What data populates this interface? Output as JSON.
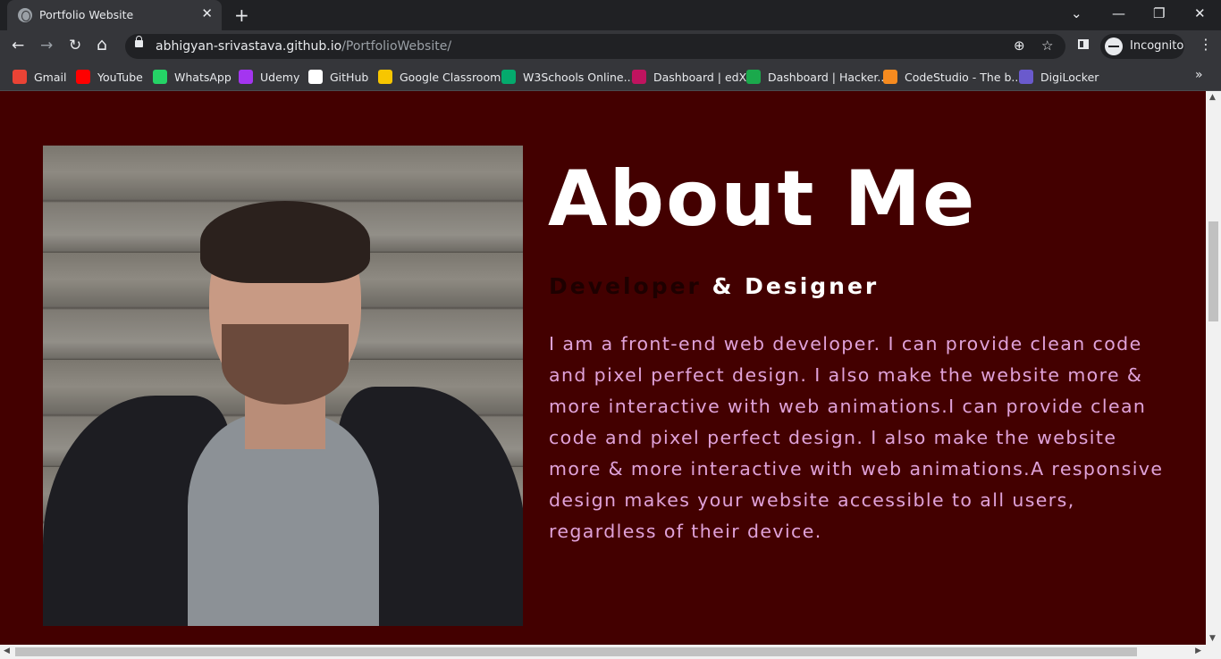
{
  "browser": {
    "tab": {
      "title": "Portfolio Website",
      "close": "✕"
    },
    "new_tab": "+",
    "window_controls": {
      "tabs_search": "⌄",
      "minimize": "—",
      "restore": "❐",
      "close": "✕"
    },
    "nav": {
      "back": "←",
      "forward": "→",
      "reload": "↻",
      "home": "⌂"
    },
    "address": {
      "host": "abhigyan-srivastava.github.io",
      "path": "/PortfolioWebsite/"
    },
    "omnibox_icons": {
      "zoom": "⊕",
      "bookmark": "☆"
    },
    "profile": {
      "label": "Incognito"
    },
    "menu": "⋮",
    "bookmarks": [
      {
        "label": "Gmail",
        "icon": "gmail-icon",
        "color": "#ea4335"
      },
      {
        "label": "YouTube",
        "icon": "youtube-icon",
        "color": "#ff0000"
      },
      {
        "label": "WhatsApp",
        "icon": "whatsapp-icon",
        "color": "#25d366"
      },
      {
        "label": "Udemy",
        "icon": "udemy-icon",
        "color": "#a435f0"
      },
      {
        "label": "GitHub",
        "icon": "github-icon",
        "color": "#ffffff"
      },
      {
        "label": "Google Classroom",
        "icon": "google-classroom-icon",
        "color": "#f7c600"
      },
      {
        "label": "W3Schools Online...",
        "icon": "w3schools-icon",
        "color": "#04aa6d"
      },
      {
        "label": "Dashboard | edX",
        "icon": "edx-icon",
        "color": "#c0135f"
      },
      {
        "label": "Dashboard | Hacker...",
        "icon": "hackerrank-icon",
        "color": "#1ba94c"
      },
      {
        "label": "CodeStudio - The b...",
        "icon": "codestudio-icon",
        "color": "#f78b1f"
      },
      {
        "label": "DigiLocker",
        "icon": "digilocker-icon",
        "color": "#6a5acd"
      }
    ],
    "bookmarks_overflow": "»"
  },
  "page": {
    "background": "#430000",
    "heading": "About Me",
    "role_dev": "Developer",
    "role_rest": " & Designer",
    "bio": "I am a front-end web developer. I can provide clean code and pixel perfect design. I also make the website more & more interactive with web animations.I can provide clean code and pixel perfect design. I also make the website more & more interactive with web animations.A responsive design makes your website accessible to all users, regardless of their device.",
    "bio_color": "#e0a2d9"
  }
}
